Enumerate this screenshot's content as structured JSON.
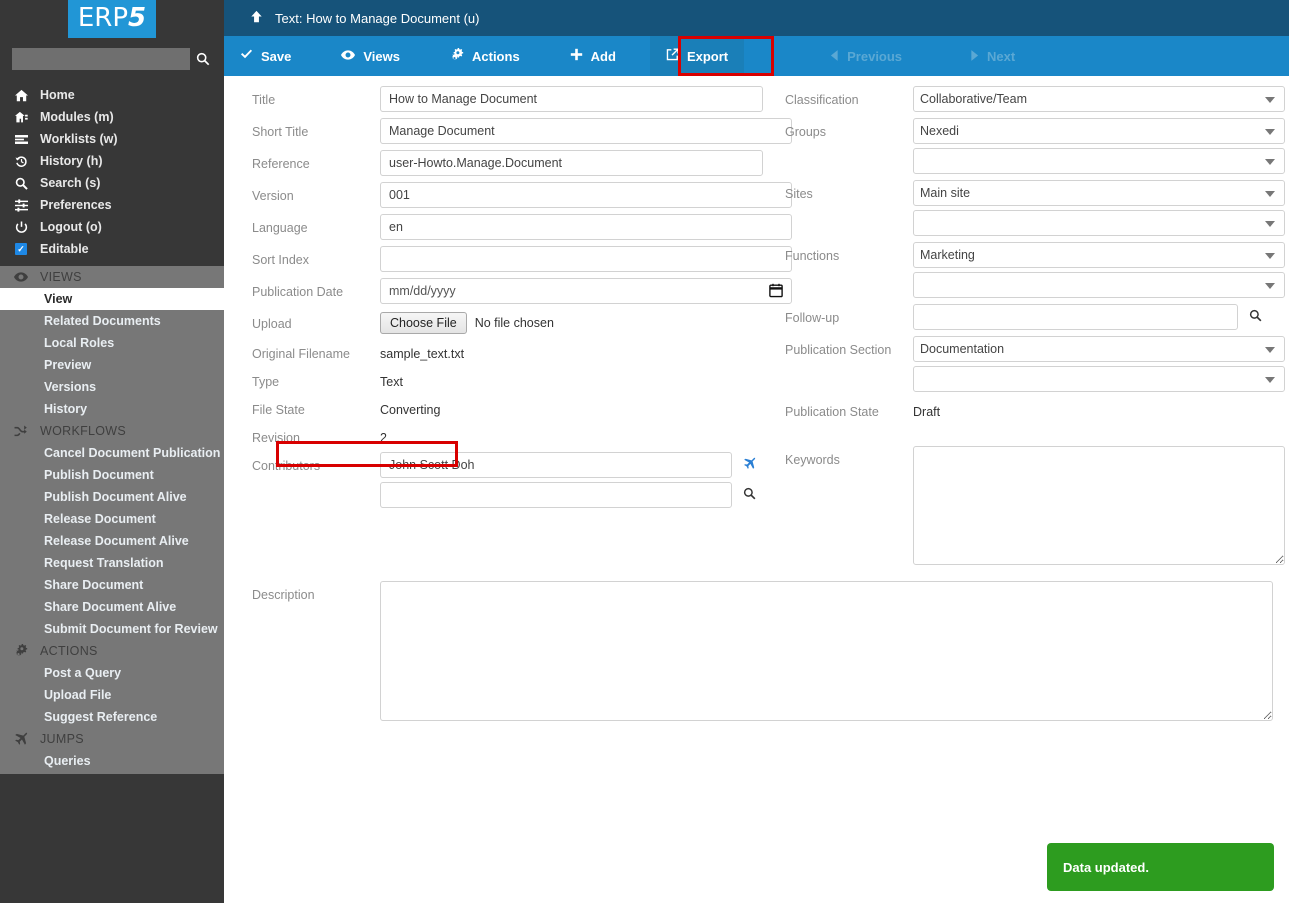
{
  "brand": {
    "logo_text": "ERP",
    "logo_digit": "5"
  },
  "search": {
    "value": "",
    "placeholder": "",
    "icon": "search-icon"
  },
  "sidebar": {
    "main_items": [
      {
        "label": "Home",
        "icon": "home-icon"
      },
      {
        "label": "Modules (m)",
        "icon": "modules-icon"
      },
      {
        "label": "Worklists (w)",
        "icon": "worklists-icon"
      },
      {
        "label": "History (h)",
        "icon": "history-icon"
      },
      {
        "label": "Search (s)",
        "icon": "search-icon"
      },
      {
        "label": "Preferences",
        "icon": "sliders-icon"
      },
      {
        "label": "Logout (o)",
        "icon": "power-icon"
      },
      {
        "label": "Editable",
        "icon": "checkbox-checked-icon"
      }
    ],
    "groups": [
      {
        "name": "VIEWS",
        "icon": "eye-icon",
        "items": [
          {
            "label": "View",
            "active": true
          },
          {
            "label": "Related Documents",
            "active": false
          },
          {
            "label": "Local Roles",
            "active": false
          },
          {
            "label": "Preview",
            "active": false
          },
          {
            "label": "Versions",
            "active": false
          },
          {
            "label": "History",
            "active": false
          }
        ]
      },
      {
        "name": "WORKFLOWS",
        "icon": "shuffle-icon",
        "items": [
          {
            "label": "Cancel Document Publication",
            "active": false
          },
          {
            "label": "Publish Document",
            "active": false
          },
          {
            "label": "Publish Document Alive",
            "active": false
          },
          {
            "label": "Release Document",
            "active": false
          },
          {
            "label": "Release Document Alive",
            "active": false
          },
          {
            "label": "Request Translation",
            "active": false
          },
          {
            "label": "Share Document",
            "active": false
          },
          {
            "label": "Share Document Alive",
            "active": false
          },
          {
            "label": "Submit Document for Review",
            "active": false
          }
        ]
      },
      {
        "name": "ACTIONS",
        "icon": "gears-icon",
        "items": [
          {
            "label": "Post a Query",
            "active": false
          },
          {
            "label": "Upload File",
            "active": false
          },
          {
            "label": "Suggest Reference",
            "active": false
          }
        ]
      },
      {
        "name": "JUMPS",
        "icon": "plane-icon",
        "items": [
          {
            "label": "Queries",
            "active": false
          }
        ]
      }
    ]
  },
  "header": {
    "title": "Text: How to Manage Document (u)",
    "up_icon": "arrow-up-icon"
  },
  "toolbar": {
    "save": "Save",
    "views": "Views",
    "actions": "Actions",
    "add": "Add",
    "export": "Export",
    "previous": "Previous",
    "next": "Next",
    "highlight_color": "#d80000"
  },
  "form": {
    "left": {
      "title": {
        "label": "Title",
        "value": "How to Manage Document"
      },
      "short_title": {
        "label": "Short Title",
        "value": "Manage Document"
      },
      "reference": {
        "label": "Reference",
        "value": "user-Howto.Manage.Document"
      },
      "version": {
        "label": "Version",
        "value": "001"
      },
      "language": {
        "label": "Language",
        "value": "en"
      },
      "sort_index": {
        "label": "Sort Index",
        "value": ""
      },
      "publication_date": {
        "label": "Publication Date",
        "value": "",
        "placeholder": "mm/dd/yyyy"
      },
      "upload": {
        "label": "Upload",
        "button": "Choose File",
        "status": "No file chosen"
      },
      "original_filename": {
        "label": "Original Filename",
        "value": "sample_text.txt"
      },
      "type": {
        "label": "Type",
        "value": "Text"
      },
      "file_state": {
        "label": "File State",
        "value": "Converting"
      },
      "revision": {
        "label": "Revision",
        "value": "2"
      },
      "contributors": {
        "label": "Contributors",
        "value_1": "John Scott Doh",
        "value_2": ""
      }
    },
    "right": {
      "classification": {
        "label": "Classification",
        "value": "Collaborative/Team"
      },
      "groups": {
        "label": "Groups",
        "value_1": "Nexedi",
        "value_2": ""
      },
      "sites": {
        "label": "Sites",
        "value_1": "Main site",
        "value_2": ""
      },
      "functions": {
        "label": "Functions",
        "value_1": "Marketing",
        "value_2": ""
      },
      "follow_up": {
        "label": "Follow-up",
        "value": ""
      },
      "publication_section": {
        "label": "Publication Section",
        "value_1": "Documentation",
        "value_2": ""
      },
      "publication_state": {
        "label": "Publication State",
        "value": "Draft"
      },
      "keywords": {
        "label": "Keywords",
        "value": ""
      }
    },
    "description": {
      "label": "Description",
      "value": ""
    }
  },
  "toast": {
    "message": "Data updated.",
    "color": "#2d9c1f"
  }
}
